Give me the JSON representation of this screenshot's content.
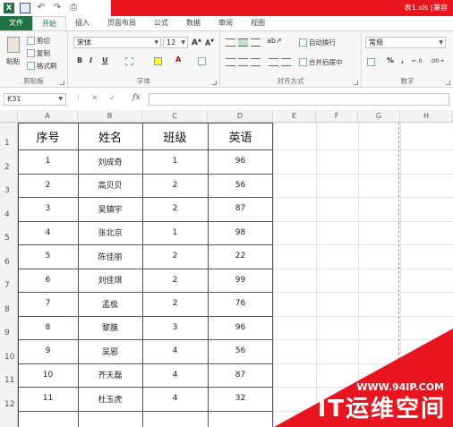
{
  "title_bar": {
    "doc_title": "表1.xls [兼容"
  },
  "tabs": [
    "文件",
    "开始",
    "插入",
    "页面布局",
    "公式",
    "数据",
    "审阅",
    "视图"
  ],
  "ribbon": {
    "clipboard": {
      "paste": "粘贴",
      "cut": "剪切",
      "copy": "复制",
      "format_painter": "格式刷",
      "label": "剪贴板"
    },
    "font": {
      "name": "宋体",
      "size": "12",
      "bold": "B",
      "italic": "I",
      "underline": "U",
      "label": "字体"
    },
    "alignment": {
      "wrap_text": "自动换行",
      "merge_center": "合并后居中",
      "label": "对齐方式"
    },
    "number": {
      "format": "常规",
      "percent": "%",
      "comma": ",",
      "label": "数字"
    }
  },
  "formula_bar": {
    "name_box": "K31",
    "cancel": "✕",
    "enter": "✓",
    "fx": "fx",
    "value": ""
  },
  "columns": [
    "A",
    "B",
    "C",
    "D",
    "E",
    "F",
    "G",
    "H"
  ],
  "row_numbers": [
    "1",
    "2",
    "3",
    "4",
    "5",
    "6",
    "7",
    "8",
    "9",
    "10",
    "11",
    "12"
  ],
  "table": {
    "headers": [
      "序号",
      "姓名",
      "班级",
      "英语"
    ],
    "rows": [
      [
        "1",
        "刘成奇",
        "1",
        "96"
      ],
      [
        "2",
        "高贝贝",
        "2",
        "56"
      ],
      [
        "3",
        "吴镇宇",
        "2",
        "87"
      ],
      [
        "4",
        "张北京",
        "1",
        "98"
      ],
      [
        "5",
        "陈佳丽",
        "2",
        "22"
      ],
      [
        "6",
        "刘佳琪",
        "2",
        "99"
      ],
      [
        "7",
        "孟极",
        "2",
        "76"
      ],
      [
        "8",
        "黎簇",
        "3",
        "96"
      ],
      [
        "9",
        "吴邪",
        "4",
        "56"
      ],
      [
        "10",
        "齐天磊",
        "4",
        "87"
      ],
      [
        "11",
        "杜玉虎",
        "4",
        "32"
      ]
    ]
  },
  "watermark": {
    "url": "WWW.94IP.COM",
    "text": "IT运维空间"
  },
  "colors": {
    "excel_green": "#217346",
    "title_red": "#e8141e",
    "watermark_red": "#e8141e"
  }
}
